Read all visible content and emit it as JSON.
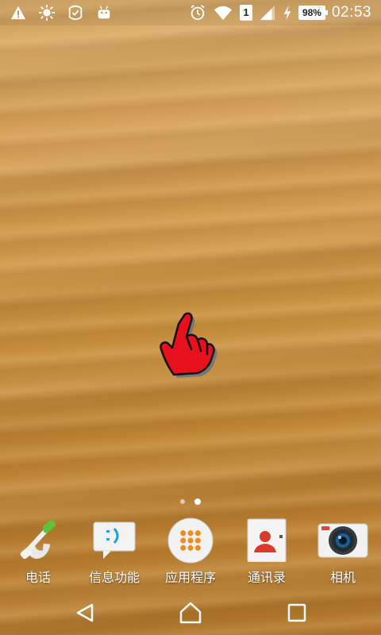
{
  "statusbar": {
    "left_icons": [
      "warning-icon",
      "sun-icon",
      "no-disturb-icon",
      "android-icon"
    ],
    "right_icons": [
      "alarm-icon",
      "wifi-icon",
      "sim-icon",
      "signal-icon",
      "charging-icon",
      "battery-icon"
    ],
    "sim_slot": "1",
    "battery_percent": "98%",
    "time": "02:53"
  },
  "home": {
    "page_count": 2,
    "active_page": 2
  },
  "dock": {
    "items": [
      {
        "label": "电话",
        "icon": "phone-icon"
      },
      {
        "label": "信息功能",
        "icon": "messaging-icon"
      },
      {
        "label": "应用程序",
        "icon": "app-drawer-icon"
      },
      {
        "label": "通讯录",
        "icon": "contacts-icon"
      },
      {
        "label": "相机",
        "icon": "camera-icon"
      }
    ]
  },
  "navbar": {
    "buttons": [
      "back-icon",
      "home-icon",
      "recents-icon"
    ]
  },
  "colors": {
    "cursor_red": "#e8101c",
    "camera_ring": "#444444"
  }
}
